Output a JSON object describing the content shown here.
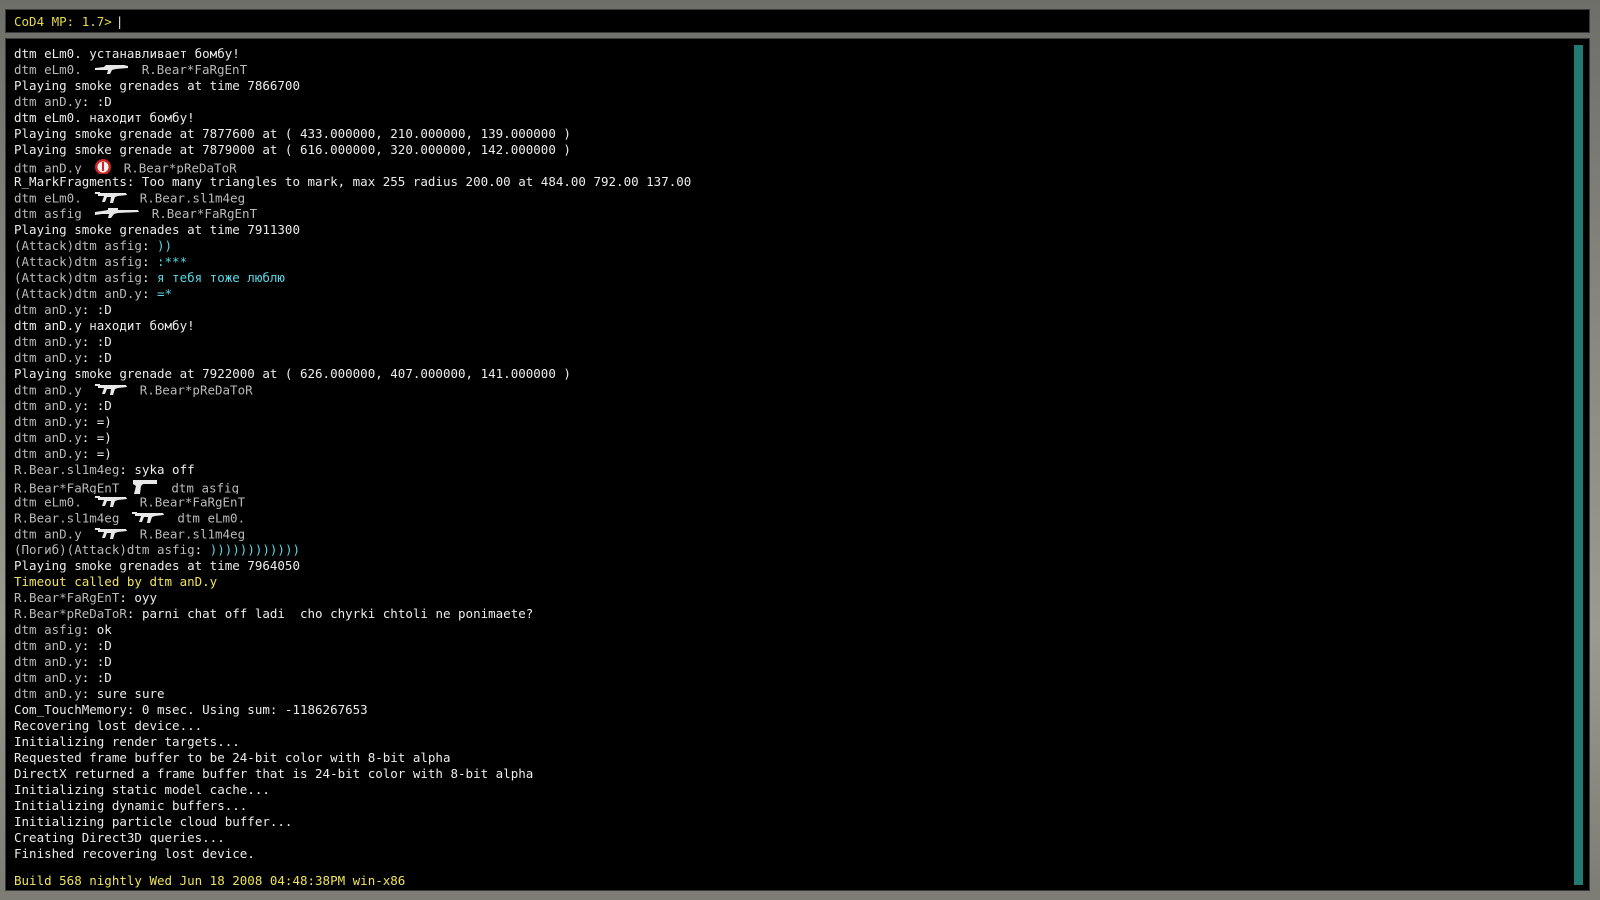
{
  "console": {
    "prompt": "CoD4 MP: 1.7>",
    "build_info": "Build 568 nightly Wed Jun 18 2008 04:48:38PM win-x86",
    "scroll_position": 1.0,
    "lines": [
      {
        "segs": [
          {
            "t": "dtm eLm0. устанавливает бомбу!",
            "c": "white"
          }
        ]
      },
      {
        "segs": [
          {
            "t": "dtm eLm0.",
            "c": "grey"
          },
          {
            "icon": "rifle-icon"
          },
          {
            "t": "R.Bear*FaRgEnT",
            "c": "grey"
          }
        ]
      },
      {
        "segs": [
          {
            "t": "Playing smoke grenades at time 7866700",
            "c": "white"
          }
        ]
      },
      {
        "segs": [
          {
            "t": "dtm anD.y",
            "c": "grey"
          },
          {
            "t": ": :D",
            "c": "white"
          }
        ]
      },
      {
        "segs": [
          {
            "t": "dtm eLm0. находит бомбу!",
            "c": "white"
          }
        ]
      },
      {
        "segs": [
          {
            "t": "Playing smoke grenade at 7877600 at ( 433.000000, 210.000000, 139.000000 )",
            "c": "white"
          }
        ]
      },
      {
        "segs": [
          {
            "t": "Playing smoke grenade at 7879000 at ( 616.000000, 320.000000, 142.000000 )",
            "c": "white"
          }
        ]
      },
      {
        "segs": [
          {
            "t": "dtm anD.y",
            "c": "grey"
          },
          {
            "icon": "grenade-icon"
          },
          {
            "t": "R.Bear*pReDaToR",
            "c": "grey"
          }
        ]
      },
      {
        "segs": [
          {
            "t": "R_MarkFragments: Too many triangles to mark, max 255 radius 200.00 at 484.00 792.00 137.00",
            "c": "white"
          }
        ]
      },
      {
        "segs": [
          {
            "t": "dtm eLm0.",
            "c": "grey"
          },
          {
            "icon": "smg-icon"
          },
          {
            "t": "R.Bear.sl1m4eg",
            "c": "grey"
          }
        ]
      },
      {
        "segs": [
          {
            "t": "dtm asfig",
            "c": "grey"
          },
          {
            "icon": "sniper-rifle-icon"
          },
          {
            "t": "R.Bear*FaRgEnT",
            "c": "grey"
          }
        ]
      },
      {
        "segs": [
          {
            "t": "Playing smoke grenades at time 7911300",
            "c": "white"
          }
        ]
      },
      {
        "segs": [
          {
            "t": "(Attack)dtm asfig",
            "c": "grey"
          },
          {
            "t": ": ",
            "c": "white"
          },
          {
            "t": "))",
            "c": "cyan"
          }
        ]
      },
      {
        "segs": [
          {
            "t": "(Attack)dtm asfig",
            "c": "grey"
          },
          {
            "t": ": ",
            "c": "white"
          },
          {
            "t": ":***",
            "c": "cyan"
          }
        ]
      },
      {
        "segs": [
          {
            "t": "(Attack)dtm asfig",
            "c": "grey"
          },
          {
            "t": ": ",
            "c": "white"
          },
          {
            "t": "я тебя тоже люблю",
            "c": "cyan"
          }
        ]
      },
      {
        "segs": [
          {
            "t": "(Attack)dtm anD.y",
            "c": "grey"
          },
          {
            "t": ": ",
            "c": "white"
          },
          {
            "t": "=*",
            "c": "cyan"
          }
        ]
      },
      {
        "segs": [
          {
            "t": "dtm anD.y",
            "c": "grey"
          },
          {
            "t": ": :D",
            "c": "white"
          }
        ]
      },
      {
        "segs": [
          {
            "t": "dtm anD.y находит бомбу!",
            "c": "white"
          }
        ]
      },
      {
        "segs": [
          {
            "t": "dtm anD.y",
            "c": "grey"
          },
          {
            "t": ": :D",
            "c": "white"
          }
        ]
      },
      {
        "segs": [
          {
            "t": "dtm anD.y",
            "c": "grey"
          },
          {
            "t": ": :D",
            "c": "white"
          }
        ]
      },
      {
        "segs": [
          {
            "t": "Playing smoke grenade at 7922000 at ( 626.000000, 407.000000, 141.000000 )",
            "c": "white"
          }
        ]
      },
      {
        "segs": [
          {
            "t": "dtm anD.y",
            "c": "grey"
          },
          {
            "icon": "smg-icon"
          },
          {
            "t": "R.Bear*pReDaToR",
            "c": "grey"
          }
        ]
      },
      {
        "segs": [
          {
            "t": "dtm anD.y",
            "c": "grey"
          },
          {
            "t": ": :D",
            "c": "white"
          }
        ]
      },
      {
        "segs": [
          {
            "t": "dtm anD.y",
            "c": "grey"
          },
          {
            "t": ": =)",
            "c": "white"
          }
        ]
      },
      {
        "segs": [
          {
            "t": "dtm anD.y",
            "c": "grey"
          },
          {
            "t": ": =)",
            "c": "white"
          }
        ]
      },
      {
        "segs": [
          {
            "t": "dtm anD.y",
            "c": "grey"
          },
          {
            "t": ": =)",
            "c": "white"
          }
        ]
      },
      {
        "segs": [
          {
            "t": "R.Bear.sl1m4eg",
            "c": "grey"
          },
          {
            "t": ": syka off",
            "c": "white"
          }
        ]
      },
      {
        "segs": [
          {
            "t": "R.Bear*FaRgEnT",
            "c": "grey"
          },
          {
            "icon": "pistol-icon"
          },
          {
            "t": "dtm asfig",
            "c": "grey"
          }
        ]
      },
      {
        "segs": [
          {
            "t": "dtm eLm0.",
            "c": "grey"
          },
          {
            "icon": "smg-icon"
          },
          {
            "t": "R.Bear*FaRgEnT",
            "c": "grey"
          }
        ]
      },
      {
        "segs": [
          {
            "t": "R.Bear.sl1m4eg",
            "c": "grey"
          },
          {
            "icon": "smg-icon"
          },
          {
            "t": "dtm eLm0.",
            "c": "grey"
          }
        ]
      },
      {
        "segs": [
          {
            "t": "dtm anD.y",
            "c": "grey"
          },
          {
            "icon": "smg-icon"
          },
          {
            "t": "R.Bear.sl1m4eg",
            "c": "grey"
          }
        ]
      },
      {
        "segs": [
          {
            "t": "(Погиб)(Attack)dtm asfig",
            "c": "grey"
          },
          {
            "t": ": ",
            "c": "white"
          },
          {
            "t": "))))))))))))",
            "c": "cyan"
          }
        ]
      },
      {
        "segs": [
          {
            "t": "Playing smoke grenades at time 7964050",
            "c": "white"
          }
        ]
      },
      {
        "segs": [
          {
            "t": "Timeout called by dtm anD.y",
            "c": "yellow"
          }
        ]
      },
      {
        "segs": [
          {
            "t": "R.Bear*FaRgEnT",
            "c": "grey"
          },
          {
            "t": ": oyy",
            "c": "white"
          }
        ]
      },
      {
        "segs": [
          {
            "t": "R.Bear*pReDaToR",
            "c": "grey"
          },
          {
            "t": ": parni chat off ladi  cho chyrki chtoli ne ponimaete?",
            "c": "white"
          }
        ]
      },
      {
        "segs": [
          {
            "t": "dtm asfig",
            "c": "grey"
          },
          {
            "t": ": ok",
            "c": "white"
          }
        ]
      },
      {
        "segs": [
          {
            "t": "dtm anD.y",
            "c": "grey"
          },
          {
            "t": ": :D",
            "c": "white"
          }
        ]
      },
      {
        "segs": [
          {
            "t": "dtm anD.y",
            "c": "grey"
          },
          {
            "t": ": :D",
            "c": "white"
          }
        ]
      },
      {
        "segs": [
          {
            "t": "dtm anD.y",
            "c": "grey"
          },
          {
            "t": ": :D",
            "c": "white"
          }
        ]
      },
      {
        "segs": [
          {
            "t": "dtm anD.y",
            "c": "grey"
          },
          {
            "t": ": sure sure",
            "c": "white"
          }
        ]
      },
      {
        "segs": [
          {
            "t": "Com_TouchMemory: 0 msec. Using sum: -1186267653",
            "c": "white"
          }
        ]
      },
      {
        "segs": [
          {
            "t": "Recovering lost device...",
            "c": "white"
          }
        ]
      },
      {
        "segs": [
          {
            "t": "Initializing render targets...",
            "c": "white"
          }
        ]
      },
      {
        "segs": [
          {
            "t": "Requested frame buffer to be 24-bit color with 8-bit alpha",
            "c": "white"
          }
        ]
      },
      {
        "segs": [
          {
            "t": "DirectX returned a frame buffer that is 24-bit color with 8-bit alpha",
            "c": "white"
          }
        ]
      },
      {
        "segs": [
          {
            "t": "Initializing static model cache...",
            "c": "white"
          }
        ]
      },
      {
        "segs": [
          {
            "t": "Initializing dynamic buffers...",
            "c": "white"
          }
        ]
      },
      {
        "segs": [
          {
            "t": "Initializing particle cloud buffer...",
            "c": "white"
          }
        ]
      },
      {
        "segs": [
          {
            "t": "Creating Direct3D queries...",
            "c": "white"
          }
        ]
      },
      {
        "segs": [
          {
            "t": "Finished recovering lost device.",
            "c": "white"
          }
        ]
      }
    ]
  },
  "colors": {
    "prompt": "#e6d84a",
    "name": "#b9b9b9",
    "text": "#ececec",
    "team_chat": "#58d7e6",
    "system": "#efe25a",
    "scrollbar": "#237a72"
  }
}
